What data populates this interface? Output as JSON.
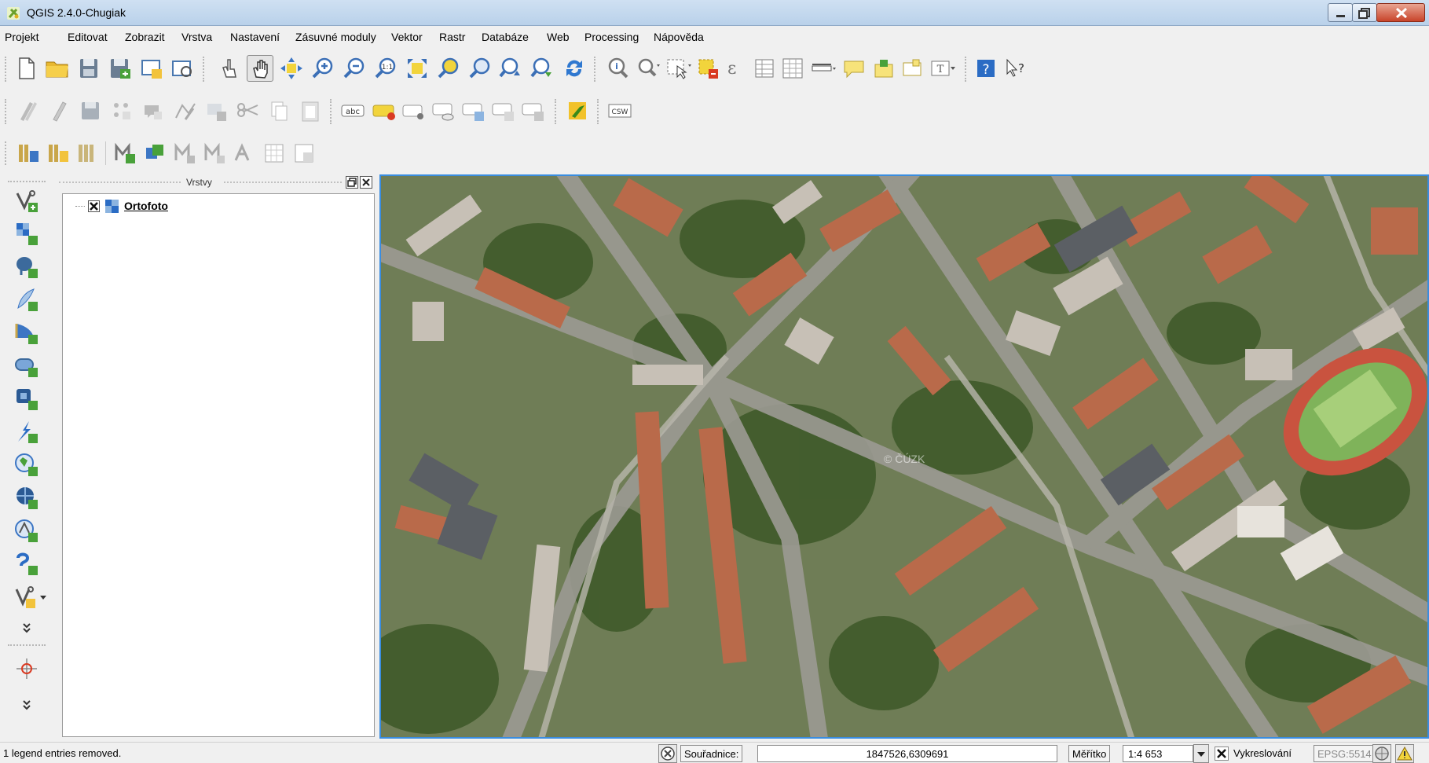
{
  "window": {
    "title": "QGIS 2.4.0-Chugiak"
  },
  "menu": [
    "Projekt",
    "Editovat",
    "Zobrazit",
    "Vrstva",
    "Nastavení",
    "Zásuvné moduly",
    "Vektor",
    "Rastr",
    "Databáze",
    "Web",
    "Processing",
    "Nápověda"
  ],
  "toolbar2": {
    "csw_label": "CSW",
    "abc_label": "abc"
  },
  "layers_panel": {
    "title": "Vrstvy",
    "layers": [
      {
        "name": "Ortofoto",
        "visible": true,
        "type": "raster"
      }
    ]
  },
  "map": {
    "watermark": "© ČÚZK"
  },
  "status": {
    "message": "1 legend entries removed.",
    "coordinates_label": "Souřadnice:",
    "coordinates_value": "1847526,6309691",
    "scale_label": "Měřítko",
    "scale_value": "1:4 653",
    "render_label": "Vykreslování",
    "crs": "EPSG:5514"
  },
  "colors": {
    "map_border": "#3a8de0",
    "close_button": "#c8442a",
    "title_bar": "#cfe0f2"
  }
}
